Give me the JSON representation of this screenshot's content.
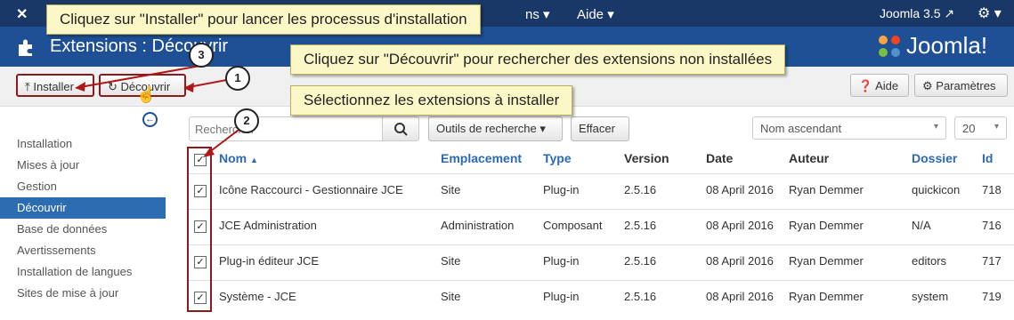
{
  "topbar": {
    "menu_partial": "ns",
    "menu_aide": "Aide",
    "version": "Joomla 3.5"
  },
  "header": {
    "title": "Extensions : Découvrir",
    "brand": "Joomla!"
  },
  "toolbar": {
    "install_label": "Installer",
    "discover_label": "Découvrir",
    "help_label": "Aide",
    "params_label": "Paramètres"
  },
  "sidebar": {
    "items": [
      {
        "label": "Installation"
      },
      {
        "label": "Mises à jour"
      },
      {
        "label": "Gestion"
      },
      {
        "label": "Découvrir",
        "active": true
      },
      {
        "label": "Base de données"
      },
      {
        "label": "Avertissements"
      },
      {
        "label": "Installation de langues"
      },
      {
        "label": "Sites de mise à jour"
      }
    ]
  },
  "filters": {
    "search_placeholder": "Rechercher",
    "tools_label": "Outils de recherche",
    "clear_label": "Effacer",
    "sort_value": "Nom ascendant",
    "limit_value": "20"
  },
  "table": {
    "headers": {
      "name": "Nom",
      "location": "Emplacement",
      "type": "Type",
      "version": "Version",
      "date": "Date",
      "author": "Auteur",
      "folder": "Dossier",
      "id": "Id"
    },
    "rows": [
      {
        "name": "Icône Raccourci - Gestionnaire JCE",
        "location": "Site",
        "type": "Plug-in",
        "version": "2.5.16",
        "date": "08 April 2016",
        "author": "Ryan Demmer",
        "folder": "quickicon",
        "id": "718",
        "checked": true
      },
      {
        "name": "JCE Administration",
        "location": "Administration",
        "type": "Composant",
        "version": "2.5.16",
        "date": "08 April 2016",
        "author": "Ryan Demmer",
        "folder": "N/A",
        "id": "716",
        "checked": true
      },
      {
        "name": "Plug-in éditeur JCE",
        "location": "Site",
        "type": "Plug-in",
        "version": "2.5.16",
        "date": "08 April 2016",
        "author": "Ryan Demmer",
        "folder": "editors",
        "id": "717",
        "checked": true
      },
      {
        "name": "Système - JCE",
        "location": "Site",
        "type": "Plug-in",
        "version": "2.5.16",
        "date": "08 April 2016",
        "author": "Ryan Demmer",
        "folder": "system",
        "id": "719",
        "checked": true
      }
    ]
  },
  "callouts": {
    "install": "Cliquez sur \"Installer\" pour lancer les processus d'installation",
    "discover": "Cliquez sur \"Découvrir\" pour rechercher des extensions non installées",
    "select": "Sélectionnez les extensions à installer",
    "badge1": "1",
    "badge2": "2",
    "badge3": "3"
  },
  "colors": {
    "topbar": "#1a3867",
    "header": "#1f5096",
    "active": "#2c6cb0",
    "link": "#2a6ab8",
    "highlight": "#8b1a1a",
    "callout_bg": "#fcf7c6"
  }
}
